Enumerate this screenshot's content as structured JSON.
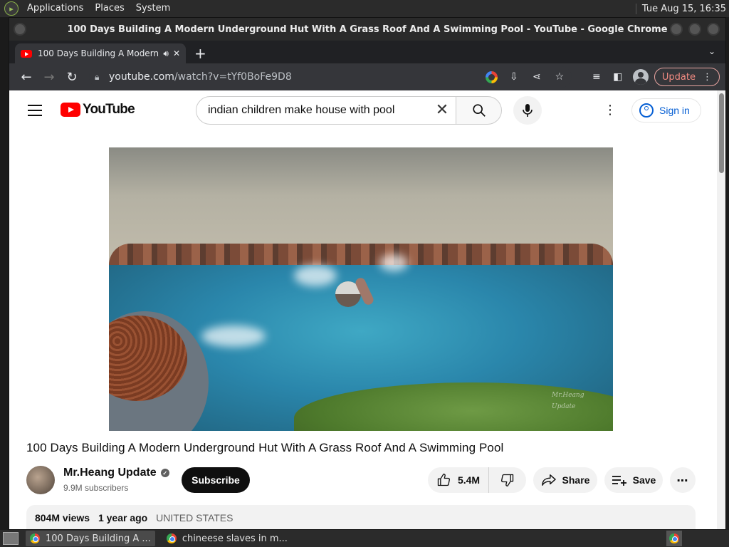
{
  "top_panel": {
    "menus": [
      "Applications",
      "Places",
      "System"
    ],
    "clock": "Tue Aug 15, 16:35"
  },
  "window": {
    "title": "100 Days Building A Modern Underground Hut With A Grass Roof And A Swimming Pool - YouTube - Google Chrome"
  },
  "tabs": [
    {
      "title": "100 Days Building A Modern Underground Hut With A Grass Roof And A Swimming Pool - YouTube",
      "icon": "youtube-favicon"
    }
  ],
  "toolbar": {
    "url_host": "youtube.com",
    "url_path": "/watch?v=tYf0BoFe9D8",
    "update_label": "Update"
  },
  "youtube": {
    "logo_text": "YouTube",
    "search_query": "indian children make house with pool",
    "sign_in_label": "Sign in",
    "video_title": "100 Days Building A Modern Underground Hut With A Grass Roof And A Swimming Pool",
    "watermark": "Mr.Heang Update",
    "channel": {
      "name": "Mr.Heang Update",
      "subscribers": "9.9M subscribers"
    },
    "subscribe_label": "Subscribe",
    "likes": "5.4M",
    "share_label": "Share",
    "save_label": "Save",
    "description": {
      "views": "804M views",
      "age": "1 year ago",
      "country": "UNITED STATES"
    }
  },
  "taskbar": {
    "tasks": [
      {
        "label": "100 Days Building A ...",
        "active": true
      },
      {
        "label": "chineese slaves in m...",
        "active": false
      }
    ]
  }
}
